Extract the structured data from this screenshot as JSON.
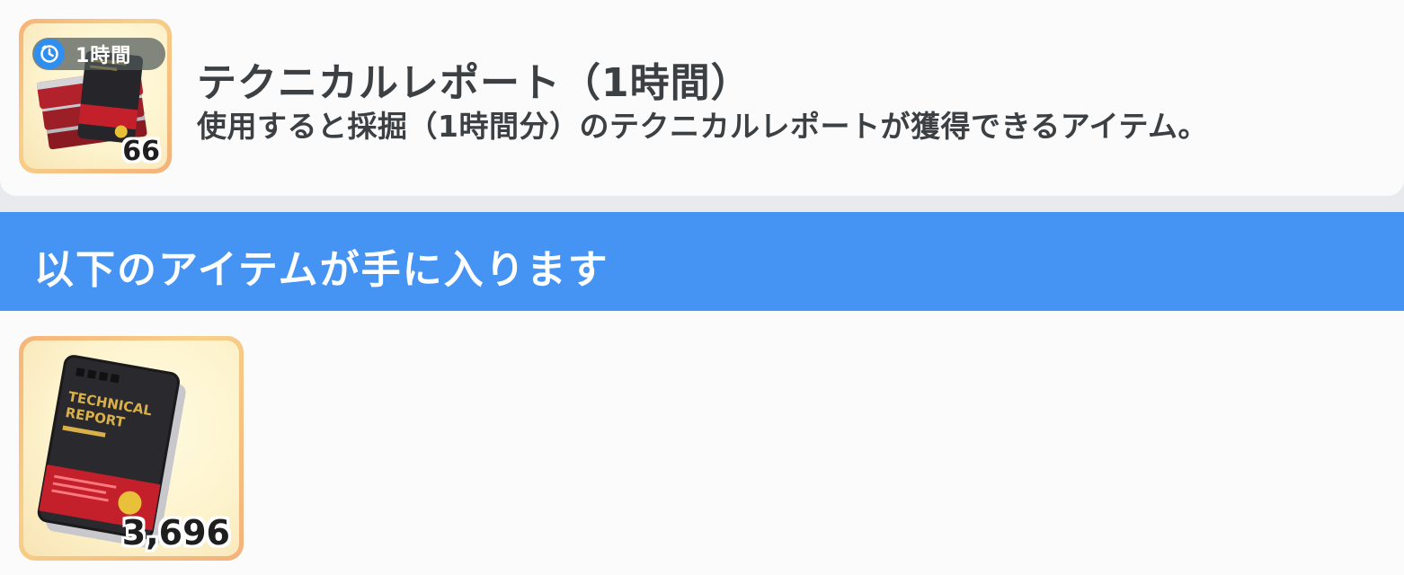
{
  "item": {
    "duration_badge": "1時間",
    "quantity": "66",
    "title": "テクニカルレポート（1時間）",
    "description": "使用すると採掘（1時間分）のテクニカルレポートが獲得できるアイテム。",
    "icon": "technical-report-stack-icon"
  },
  "rewards": {
    "header": "以下のアイテムが手に入ります",
    "items": [
      {
        "icon": "technical-report-book-icon",
        "cover_text": "TECHNICAL\nREPORT",
        "cover_line1": "TECHNICAL",
        "cover_line2": "REPORT",
        "quantity": "3,696"
      }
    ]
  },
  "colors": {
    "banner": "#4594f3",
    "card_background": "#fbfbfb",
    "frame_gradient": "#f6b478",
    "clock_badge": "#2f8ff0",
    "book_cover": "#2a2a2e",
    "book_red": "#c4202c",
    "book_gold": "#d9b04a"
  }
}
